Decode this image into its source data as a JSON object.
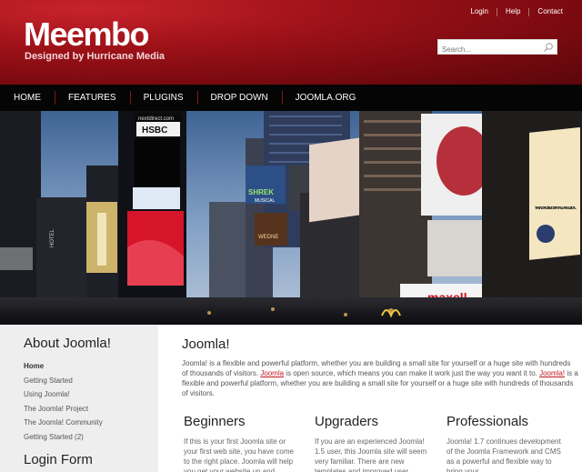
{
  "header": {
    "logo_title": "Meembo",
    "logo_subtitle": "Designed by Hurricane Media",
    "top_links": [
      "Login",
      "Help",
      "Contact"
    ],
    "search_placeholder": "Search..."
  },
  "nav": {
    "items": [
      "HOME",
      "FEATURES",
      "PLUGINS",
      "DROP DOWN",
      "JOOMLA.ORG"
    ]
  },
  "banner": {
    "signs": {
      "hsbc": "HSBC",
      "hsbc_top": "nextdirect.com",
      "shrek": "SHREK",
      "shrek_sub": "MUSICAL",
      "maxell": "maxell",
      "hotel": "HOTEL",
      "wedne": "WEDNE",
      "most_popular": "THE WORLD'S MOST POPULAR MUSICAL"
    }
  },
  "sidebar": {
    "title": "About Joomla!",
    "items": [
      "Home",
      "Getting Started",
      "Using Joomla!",
      "The Joomla! Project",
      "The Joomla! Community",
      "Getting Started (2)"
    ],
    "login_title": "Login Form"
  },
  "main": {
    "title": "Joomla!",
    "intro_a": "Joomla! is a flexible and powerful platform, whether you are building a small site for yourself or a huge site with hundreds of thousands of visitors. ",
    "intro_link1": "Joomla",
    "intro_b": " is open source, which means you can make it work just the way you want it to. ",
    "intro_link2": "Joomla!",
    "intro_c": " is a flexible and powerful platform, whether you are building a small site for yourself or a huge site with hundreds of thousands of visitors.",
    "columns": [
      {
        "title": "Beginners",
        "text": "If this is your first Joomla site or your first web site, you have come to the right place. Joomla will help you get your website up and"
      },
      {
        "title": "Upgraders",
        "text": "If you are an experienced Joomla! 1.5 user, this Joomla site will seem very familiar. There are new templates and improved user"
      },
      {
        "title": "Professionals",
        "text": "Joomla! 1.7 continues development of the Joomla Framework and CMS as a powerful and flexible way to bring your"
      }
    ]
  },
  "colors": {
    "header_red": "#a01219",
    "nav_black": "#050505",
    "link_red": "#c3151d",
    "sidebar_gray": "#eeeeee"
  }
}
